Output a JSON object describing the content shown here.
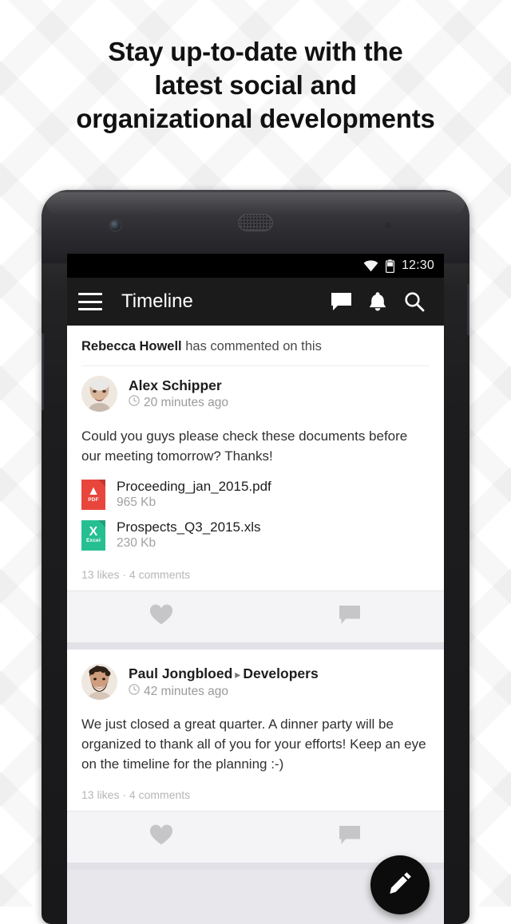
{
  "headline": "Stay up-to-date with the\nlatest social and\norganizational developments",
  "device": {
    "camera_icon": "front-camera",
    "speaker_icon": "earpiece-speaker",
    "sensor_icon": "proximity-sensor",
    "volume_button": "volume-rocker",
    "power_button": "power-button"
  },
  "status_bar": {
    "wifi_icon": "wifi-icon",
    "battery_icon": "battery-icon",
    "time": "12:30"
  },
  "app_bar": {
    "menu_icon": "hamburger-menu-icon",
    "title": "Timeline",
    "actions": [
      {
        "icon": "chat-icon",
        "label": "Messages"
      },
      {
        "icon": "bell-icon",
        "label": "Notifications"
      },
      {
        "icon": "search-icon",
        "label": "Search"
      }
    ]
  },
  "feed": {
    "posts": [
      {
        "context": {
          "actor": "Rebecca Howell",
          "action": " has commented on this"
        },
        "author": "Alex Schipper",
        "group": "",
        "group_separator": "",
        "clock_icon": "clock-icon",
        "timestamp": "20 minutes ago",
        "text": "Could you guys please check these documents before our meeting tomorrow? Thanks!",
        "attachments": [
          {
            "name": "Proceeding_jan_2015.pdf",
            "size": "965 Kb",
            "type": "pdf",
            "glyph": "A",
            "ext_label": "PDF",
            "color": "#E8453C"
          },
          {
            "name": "Prospects_Q3_2015.xls",
            "size": "230 Kb",
            "type": "excel",
            "glyph": "X",
            "ext_label": "Excel",
            "color": "#26BF92"
          }
        ],
        "stats": "13 likes · 4 comments",
        "actions": [
          {
            "icon": "heart-icon",
            "label": "Like"
          },
          {
            "icon": "comment-icon",
            "label": "Comment"
          }
        ]
      },
      {
        "context": null,
        "author": "Paul Jongbloed",
        "group": "Developers",
        "group_separator": "▸",
        "clock_icon": "clock-icon",
        "timestamp": "42 minutes ago",
        "text": "We just closed a great quarter. A dinner party will be organized to thank all of you for your efforts! Keep an eye on the timeline for the planning :-)",
        "attachments": [],
        "stats": "13 likes · 4 comments",
        "actions": [
          {
            "icon": "heart-icon",
            "label": "Like"
          },
          {
            "icon": "comment-icon",
            "label": "Comment"
          }
        ]
      }
    ]
  },
  "fab": {
    "icon": "pencil-icon",
    "label": "Compose",
    "color": "#0c0c0c"
  },
  "colors": {
    "app_bar": "#1b1b1b",
    "status_bar": "#000000",
    "feed_background": "#e8e8ec",
    "card": "#ffffff",
    "action_bar": "#f4f4f6",
    "pdf": "#E8453C",
    "excel": "#26BF92",
    "muted_text": "#9a9a9a"
  }
}
